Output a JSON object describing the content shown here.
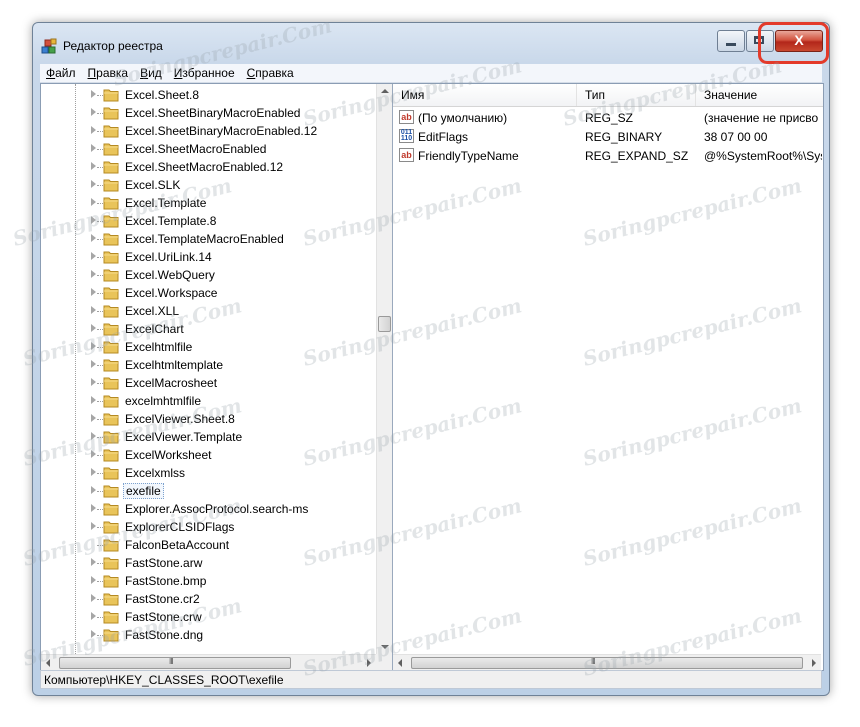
{
  "window": {
    "title": "Редактор реестра",
    "close_glyph": "X",
    "colors": {
      "frame": "#bcd0e6",
      "close": "#c9482f",
      "highlight": "#e33a2a"
    }
  },
  "menu": [
    {
      "label": "Файл",
      "accel": "Ф",
      "rest": "айл"
    },
    {
      "label": "Правка",
      "accel": "П",
      "rest": "равка"
    },
    {
      "label": "Вид",
      "accel": "В",
      "rest": "ид"
    },
    {
      "label": "Избранное",
      "accel": "И",
      "rest": "збранное"
    },
    {
      "label": "Справка",
      "accel": "С",
      "rest": "правка"
    }
  ],
  "tree": {
    "selected": "exefile",
    "items": [
      "Excel.Sheet.8",
      "Excel.SheetBinaryMacroEnabled",
      "Excel.SheetBinaryMacroEnabled.12",
      "Excel.SheetMacroEnabled",
      "Excel.SheetMacroEnabled.12",
      "Excel.SLK",
      "Excel.Template",
      "Excel.Template.8",
      "Excel.TemplateMacroEnabled",
      "Excel.UriLink.14",
      "Excel.WebQuery",
      "Excel.Workspace",
      "Excel.XLL",
      "ExcelChart",
      "Excelhtmlfile",
      "Excelhtmltemplate",
      "ExcelMacrosheet",
      "excelmhtmlfile",
      "ExcelViewer.Sheet.8",
      "ExcelViewer.Template",
      "ExcelWorksheet",
      "Excelxmlss",
      "exefile",
      "Explorer.AssocProtocol.search-ms",
      "ExplorerCLSIDFlags",
      "FalconBetaAccount",
      "FastStone.arw",
      "FastStone.bmp",
      "FastStone.cr2",
      "FastStone.crw",
      "FastStone.dng"
    ],
    "no_expander": [
      "FalconBetaAccount"
    ]
  },
  "list": {
    "columns": [
      "Имя",
      "Тип",
      "Значение"
    ],
    "rows": [
      {
        "icon": "string-value-icon",
        "icon_text": "ab",
        "name": "(По умолчанию)",
        "type": "REG_SZ",
        "value": "(значение не присво"
      },
      {
        "icon": "binary-value-icon",
        "icon_text": "011 110",
        "name": "EditFlags",
        "type": "REG_BINARY",
        "value": "38 07 00 00"
      },
      {
        "icon": "string-value-icon",
        "icon_text": "ab",
        "name": "FriendlyTypeName",
        "type": "REG_EXPAND_SZ",
        "value": "@%SystemRoot%\\Sys"
      }
    ]
  },
  "scroll": {
    "grip": "III"
  },
  "status": "Компьютер\\HKEY_CLASSES_ROOT\\exefile",
  "watermark": "Soringpcrepair.Com"
}
